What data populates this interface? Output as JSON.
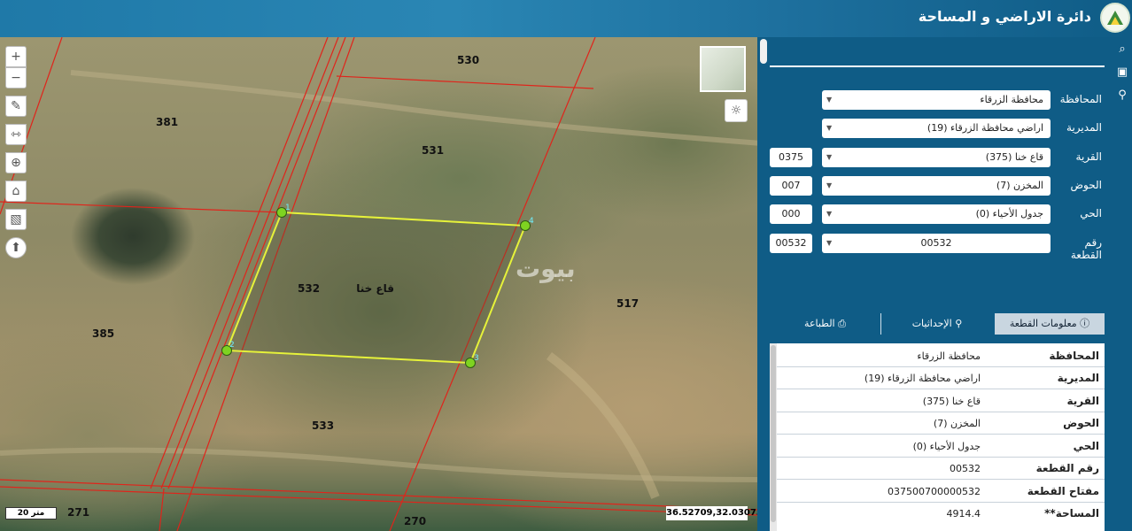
{
  "header": {
    "title": "دائرة الاراضي و المساحة",
    "logo_icon": "dls-logo-icon"
  },
  "map": {
    "parcel_labels": [
      "530",
      "381",
      "531",
      "532",
      "517",
      "385",
      "533",
      "271",
      "270"
    ],
    "parcel_name": "قاع خنا",
    "vertex_labels": [
      "1",
      "2",
      "3",
      "4"
    ],
    "watermark": "بيوت",
    "scale_text": "20 متر",
    "coordinates": "36.52709,32.03073",
    "controls": [
      "zoom-in-icon",
      "zoom-out-icon",
      "draw-icon",
      "measure-icon",
      "locate-icon",
      "home-icon",
      "export-icon",
      "compass-icon"
    ],
    "colors": {
      "boundary": "#e0241b",
      "parcel": "#e6f23a",
      "vertex": "#7ed321"
    }
  },
  "filters": [
    {
      "label": "المحافظة",
      "value": "محافظة الزرقاء",
      "code": ""
    },
    {
      "label": "المديرية",
      "value": "اراضي محافظة الزرقاء (19)",
      "code": ""
    },
    {
      "label": "القرية",
      "value": "قاع خنا (375)",
      "code": "0375"
    },
    {
      "label": "الحوض",
      "value": "المخزن (7)",
      "code": "007"
    },
    {
      "label": "الحي",
      "value": "جدول الأحياء (0)",
      "code": "000"
    },
    {
      "label": "رقم القطعة",
      "value": "00532",
      "code": "00532"
    }
  ],
  "tabs": [
    {
      "label": "معلومات القطعة",
      "icon": "info-icon",
      "active": true
    },
    {
      "label": "الإحداثيات",
      "icon": "user-pin-icon",
      "active": false
    },
    {
      "label": "الطباعة",
      "icon": "printer-icon",
      "active": false
    }
  ],
  "info": [
    {
      "key": "المحافظة",
      "value": "محافظة الزرقاء"
    },
    {
      "key": "المديرية",
      "value": "اراضي محافظة الزرقاء (19)"
    },
    {
      "key": "القرية",
      "value": "قاع خنا (375)"
    },
    {
      "key": "الحوض",
      "value": "المخزن (7)"
    },
    {
      "key": "الحي",
      "value": "جدول الأحياء (0)"
    },
    {
      "key": "رقم القطعة",
      "value": "00532"
    },
    {
      "key": "مفتاح القطعة",
      "value": "037500700000532"
    },
    {
      "key": "المساحة**",
      "value": "4914.4"
    }
  ]
}
